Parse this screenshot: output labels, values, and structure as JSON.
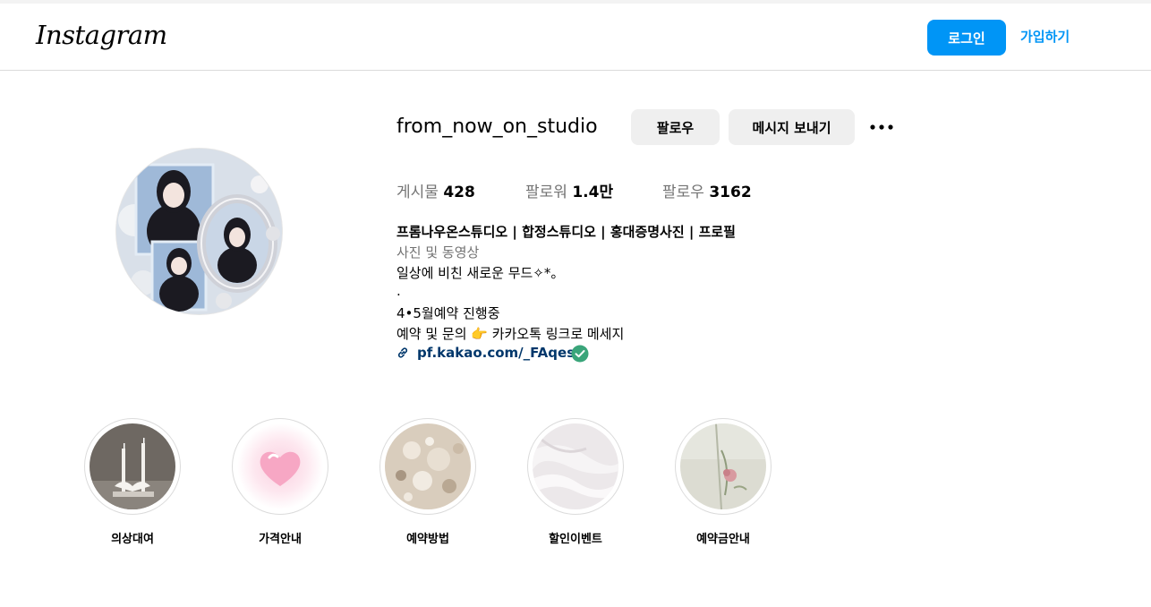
{
  "header": {
    "logo_text": "Instagram",
    "login_label": "로그인",
    "signup_label": "가입하기",
    "colors": {
      "primary": "#0095f6"
    }
  },
  "profile": {
    "username": "from_now_on_studio",
    "follow_label": "팔로우",
    "message_label": "메시지 보내기",
    "more_icon": "more-horizontal-icon",
    "stats": [
      {
        "label": "게시물",
        "value": "428"
      },
      {
        "label": "팔로워",
        "value": "1.4만"
      },
      {
        "label": "팔로우",
        "value": "3162"
      }
    ],
    "full_name": "프롬나우온스튜디오 | 합정스튜디오 | 홍대증명사진 | 프로필",
    "category": "사진 및 동영상",
    "bio_lines": [
      "일상에 비친 새로운 무드✧*。",
      ".",
      "4•5월예약 진행중",
      "예약 및 문의 👉 카카오톡 링크로 메세지"
    ],
    "link_text": "pf.kakao.com/_FAqes",
    "link_icon": "link-icon",
    "verified_icon": "verified-check-icon"
  },
  "highlights": [
    {
      "label": "의상대여"
    },
    {
      "label": "가격안내"
    },
    {
      "label": "예약방법"
    },
    {
      "label": "할인이벤트"
    },
    {
      "label": "예약금안내"
    }
  ]
}
